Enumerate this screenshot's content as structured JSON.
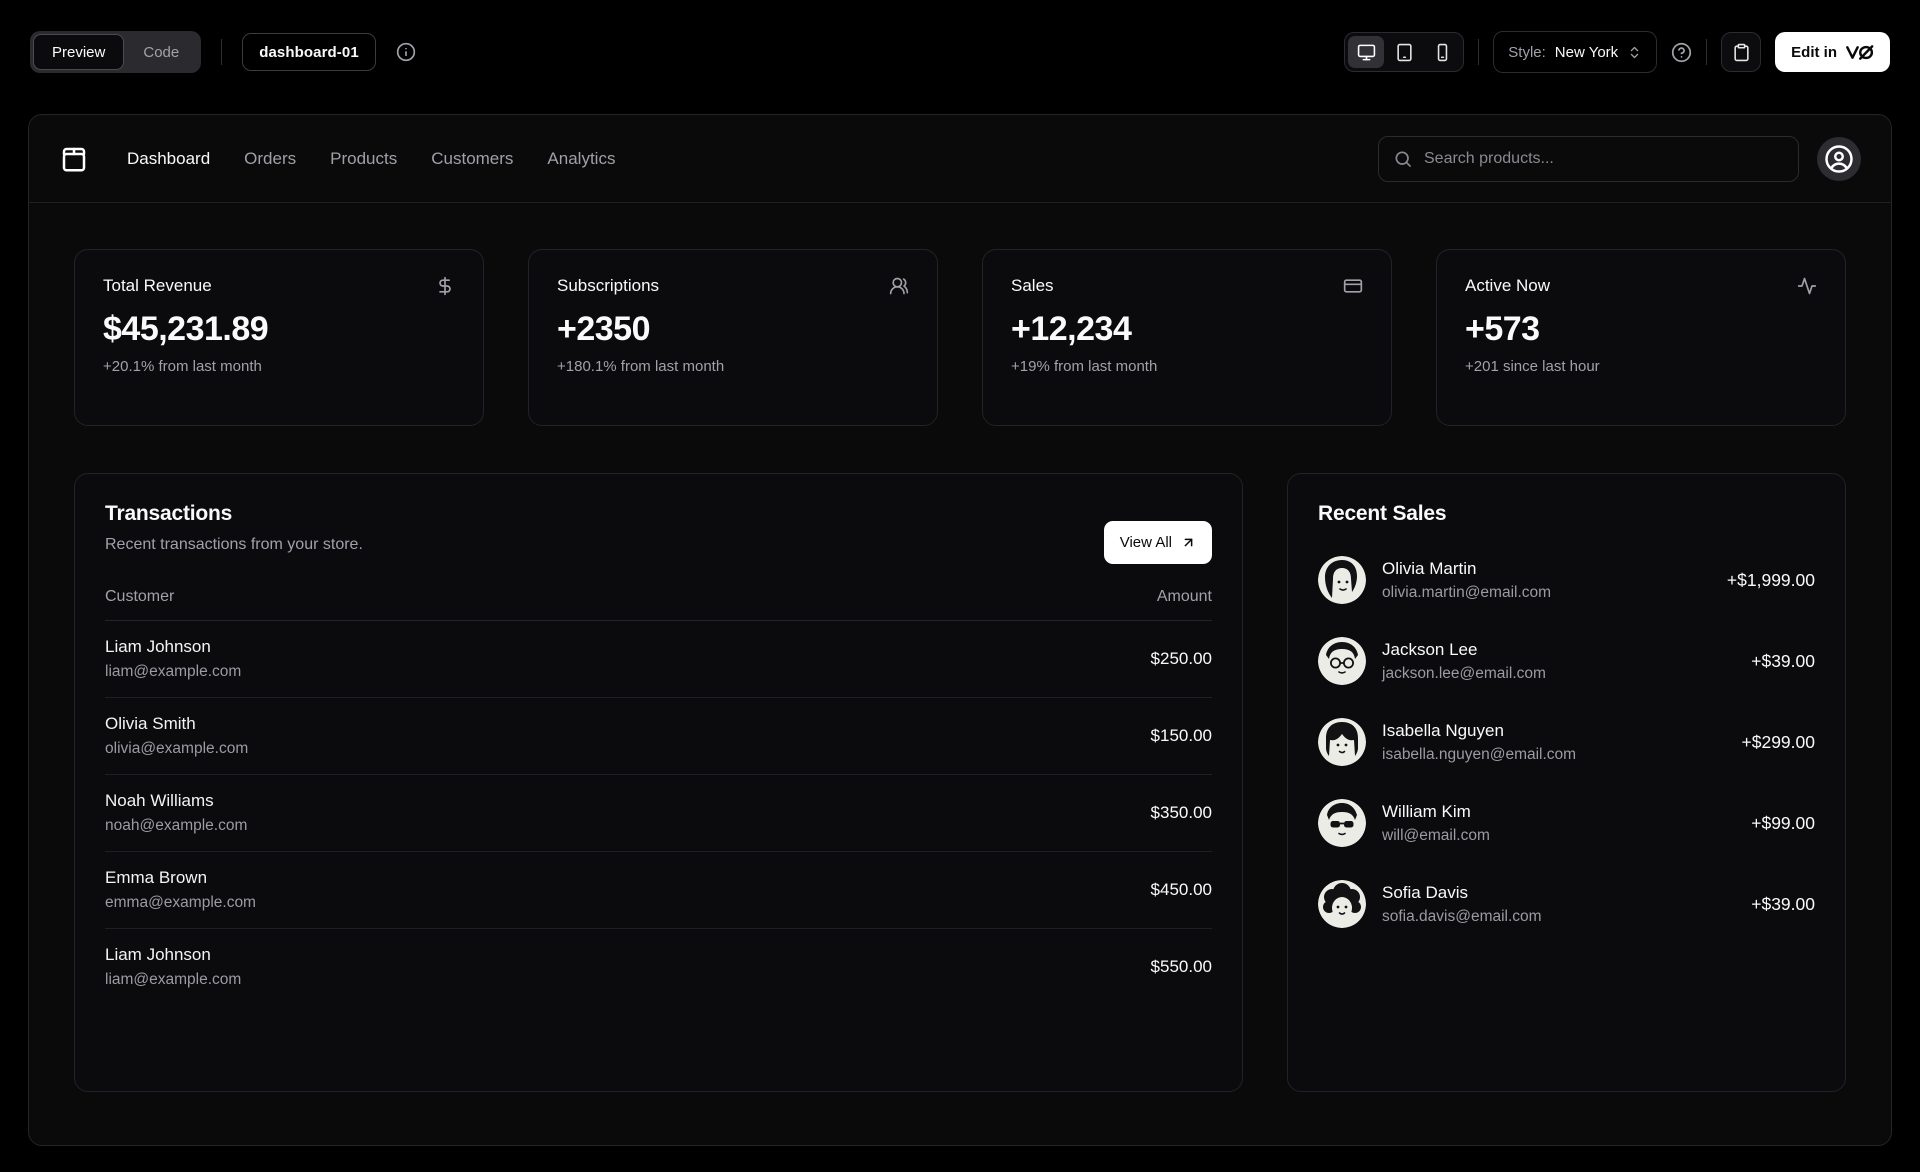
{
  "toolbar": {
    "tabs": {
      "preview": "Preview",
      "code": "Code"
    },
    "block_badge": "dashboard-01",
    "style_label": "Style:",
    "style_value": "New York",
    "edit_button": "Edit in",
    "icons": [
      "info-icon",
      "monitor-icon",
      "tablet-icon",
      "smartphone-icon",
      "chevrons-up-down-icon",
      "help-circle-icon",
      "clipboard-icon",
      "v0-logo-icon"
    ]
  },
  "nav": {
    "links": [
      "Dashboard",
      "Orders",
      "Products",
      "Customers",
      "Analytics"
    ],
    "active_link": "Dashboard",
    "search_placeholder": "Search products...",
    "icons": [
      "package-icon",
      "search-icon",
      "user-circle-icon"
    ]
  },
  "stats": [
    {
      "title": "Total Revenue",
      "value": "$45,231.89",
      "change": "+20.1% from last month",
      "icon": "dollar-sign-icon"
    },
    {
      "title": "Subscriptions",
      "value": "+2350",
      "change": "+180.1% from last month",
      "icon": "users-icon"
    },
    {
      "title": "Sales",
      "value": "+12,234",
      "change": "+19% from last month",
      "icon": "credit-card-icon"
    },
    {
      "title": "Active Now",
      "value": "+573",
      "change": "+201 since last hour",
      "icon": "activity-icon"
    }
  ],
  "transactions": {
    "title": "Transactions",
    "subtitle": "Recent transactions from your store.",
    "view_all": "View All",
    "view_all_icon": "arrow-up-right-icon",
    "columns": [
      "Customer",
      "Amount"
    ],
    "rows": [
      {
        "name": "Liam Johnson",
        "email": "liam@example.com",
        "amount": "$250.00"
      },
      {
        "name": "Olivia Smith",
        "email": "olivia@example.com",
        "amount": "$150.00"
      },
      {
        "name": "Noah Williams",
        "email": "noah@example.com",
        "amount": "$350.00"
      },
      {
        "name": "Emma Brown",
        "email": "emma@example.com",
        "amount": "$450.00"
      },
      {
        "name": "Liam Johnson",
        "email": "liam@example.com",
        "amount": "$550.00"
      }
    ]
  },
  "recent_sales": {
    "title": "Recent Sales",
    "items": [
      {
        "name": "Olivia Martin",
        "email": "olivia.martin@email.com",
        "amount": "+$1,999.00",
        "avatar": "illustrated-woman-bob"
      },
      {
        "name": "Jackson Lee",
        "email": "jackson.lee@email.com",
        "amount": "+$39.00",
        "avatar": "illustrated-man-glasses"
      },
      {
        "name": "Isabella Nguyen",
        "email": "isabella.nguyen@email.com",
        "amount": "+$299.00",
        "avatar": "illustrated-woman-bangs"
      },
      {
        "name": "William Kim",
        "email": "will@email.com",
        "amount": "+$99.00",
        "avatar": "illustrated-man-sunglasses"
      },
      {
        "name": "Sofia Davis",
        "email": "sofia.davis@email.com",
        "amount": "+$39.00",
        "avatar": "illustrated-woman-curly"
      }
    ]
  },
  "colors": {
    "page_background": "#000000",
    "panel_background": "#0a0a0b",
    "card_border": "#222228",
    "text": "#fafafa",
    "muted_text": "#a1a1aa",
    "accent_button": "#ffffff",
    "accent_button_text": "#0a0a0a"
  }
}
